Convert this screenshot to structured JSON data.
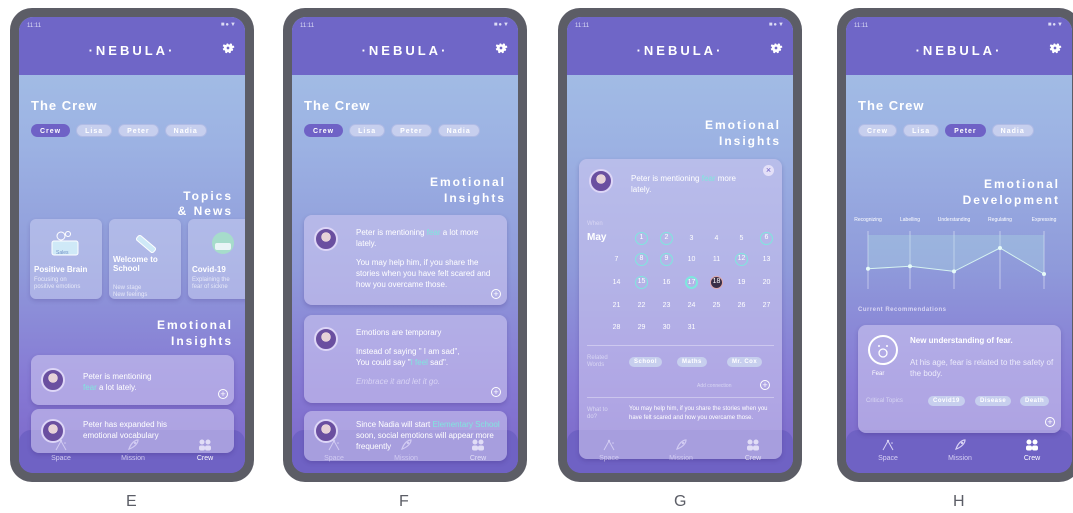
{
  "app": {
    "logo": "·NEBULA·",
    "time": "11:11",
    "status_icons": "■●▼"
  },
  "nav": {
    "space": "Space",
    "mission": "Mission",
    "crew": "Crew"
  },
  "crew_title": "The Crew",
  "crew_tabs": [
    "Crew",
    "Lisa",
    "Peter",
    "Nadia"
  ],
  "screens": {
    "E": {
      "letter": "E",
      "topics_title_1": "Topics",
      "topics_title_2": "& News",
      "topics": [
        {
          "title": "Positive Brain",
          "sub1": "Focusing on",
          "sub2": "positive emotions",
          "icon_label": "Sales"
        },
        {
          "title": "Welcome to School",
          "sub1": "New stage",
          "sub2": "New feelings"
        },
        {
          "title": "Covid-19",
          "sub1": "Explaining the",
          "sub2": "fear of sickne"
        }
      ],
      "insights_title_1": "Emotional",
      "insights_title_2": "Insights",
      "card1_a": "Peter is mentioning",
      "card1_hl": "fear",
      "card1_b": "a lot lately.",
      "card2_a": "Peter has expanded his",
      "card2_b": "emotional vocabulary"
    },
    "F": {
      "letter": "F",
      "insights_title_1": "Emotional",
      "insights_title_2": "Insights",
      "card1_a": "Peter is mentioning",
      "card1_hl": "fear",
      "card1_b": "a lot more",
      "card1_c": "lately.",
      "card1_d": "You may help him, if you share the stories when you have felt scared and how you overcame those.",
      "card2_title": "Emotions are temporary",
      "card2_a": "Instead of saying \" I am sad\",",
      "card2_b": "You could say \"",
      "card2_hl": "I feel",
      "card2_c": " sad\".",
      "card2_d": "Embrace it and let it go.",
      "card3_a": "Since Nadia will start",
      "card3_hl": "Elementary School",
      "card3_b": "soon, social emotions will appear more frequently"
    },
    "G": {
      "letter": "G",
      "insights_title_1": "Emotional",
      "insights_title_2": "Insights",
      "card_a": "Peter is mentioning",
      "card_hl": "fear",
      "card_b": "more",
      "card_c": "lately.",
      "close": "×",
      "when_label": "When",
      "month": "May",
      "days": [
        [
          1,
          2,
          3,
          4,
          5,
          6
        ],
        [
          7,
          8,
          9,
          10,
          11,
          12,
          13
        ],
        [
          14,
          15,
          16,
          17,
          18,
          19,
          20
        ],
        [
          21,
          22,
          23,
          24,
          25,
          26,
          27
        ],
        [
          28,
          29,
          30,
          31
        ]
      ],
      "marked_days": [
        1,
        2,
        6,
        8,
        9,
        12,
        15,
        17
      ],
      "today": 17,
      "dark_day": 18,
      "related_label": "Related Words",
      "related_words": [
        "School",
        "Maths",
        "Mr. Cox"
      ],
      "add_connection": "Add connection",
      "what_label": "What to do?",
      "what_text": "You may help him, if you share the stories when you have felt scared and how you overcame those."
    },
    "H": {
      "letter": "H",
      "dev_title_1": "Emotional",
      "dev_title_2": "Development",
      "stages": [
        "Recognizing",
        "Labelling",
        "Understanding",
        "Regulating",
        "Expressing"
      ],
      "stage_levels": [
        0.35,
        0.4,
        0.3,
        0.75,
        0.25
      ],
      "recommend_label": "Current Recommendations",
      "rec_title": "New understanding of fear.",
      "rec_text": "At his age, fear is related to the safety of the body.",
      "fear_label": "Fear",
      "critical_label": "Critical Topics",
      "critical_topics": [
        "Covid19",
        "Disease",
        "Death"
      ]
    }
  },
  "colors": {
    "accent": "#7fe7de",
    "header": "#6f66c7",
    "nav": "#6f62c4"
  }
}
